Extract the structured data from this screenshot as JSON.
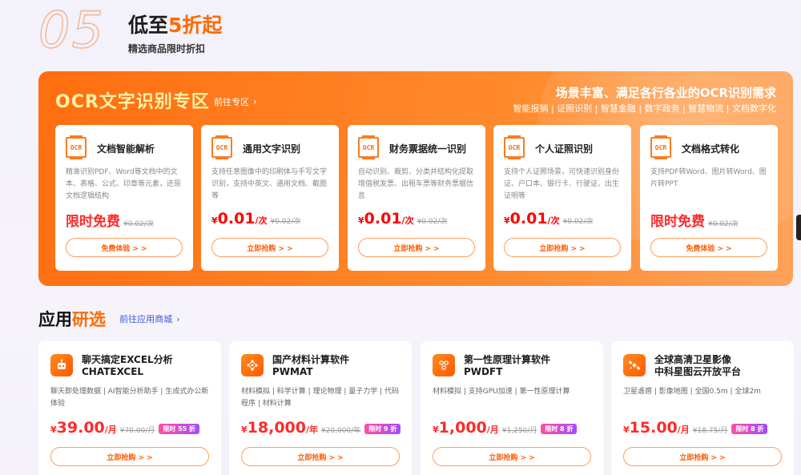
{
  "section": {
    "number": "05",
    "title_prefix": "低至",
    "title_highlight": "5折起",
    "subtitle": "精选商品限时折扣"
  },
  "ocr": {
    "title": "OCR文字识别专区",
    "link_label": "前往专区",
    "slogan": "场景丰富、满足各行各业的OCR识别需求",
    "tags": "智能报销 | 证照识别 | 智慧金融 | 数字政务 | 智慧物流 | 文档数字化",
    "icon_text": "OCR",
    "cards": [
      {
        "name": "文档智能解析",
        "desc": "精准识别PDF、Word等文档中的文本、表格、公式、印章等元素，还原文档逻辑结构",
        "free_label": "限时免费",
        "orig_price": "¥0.02/次",
        "button": "免费体验 > >"
      },
      {
        "name": "通用文字识别",
        "desc": "支持任意图像中的印刷体与手写文字识别，支持中英文、通用文档、截图等",
        "currency": "¥",
        "price": "0.01",
        "unit": "/次",
        "orig_price": "¥0.02/次",
        "button": "立即抢购 > >"
      },
      {
        "name": "财务票据统一识别",
        "desc": "自动识别、裁剪、分类并结构化提取增值税发票、出租车票等财务票据信息",
        "currency": "¥",
        "price": "0.01",
        "unit": "/次",
        "orig_price": "¥0.02/次",
        "button": "立即抢购 > >"
      },
      {
        "name": "个人证照识别",
        "desc": "支持个人证照场景，可快速识别身份证、户口本、银行卡、行驶证、出生证明等",
        "currency": "¥",
        "price": "0.01",
        "unit": "/次",
        "orig_price": "¥0.02/次",
        "button": "立即抢购 > >"
      },
      {
        "name": "文档格式转化",
        "desc": "支持PDF转Word、图片转Word、图片转PPT",
        "free_label": "限时免费",
        "orig_price": "¥0.02/次",
        "button": "免费体验 > >"
      }
    ]
  },
  "apps": {
    "title_prefix": "应用",
    "title_highlight": "研选",
    "link_label": "前往应用商城",
    "cards": [
      {
        "name_line1": "聊天搞定EXCEL分析",
        "name_line2": "CHATEXCEL",
        "icon": "robot-icon",
        "desc": "聊天即处理数据 | AI智能分析助手 | 生成式办公新体验",
        "currency": "¥",
        "price": "39.00",
        "unit": "/月",
        "orig_price": "¥70.00/月",
        "discount": "限时 55 折",
        "button": "立即抢购 > >"
      },
      {
        "name_line1": "国产材料计算软件",
        "name_line2": "PWMAT",
        "icon": "molecule-icon",
        "desc": "材料模拟 | 科学计算 | 理论物理 | 量子力学 | 代码程序 | 材料计算",
        "currency": "¥",
        "price": "18,000",
        "unit": "/年",
        "orig_price": "¥20,000/年",
        "discount": "限时 9 折",
        "button": "立即抢购 > >"
      },
      {
        "name_line1": "第一性原理计算软件",
        "name_line2": "PWDFT",
        "icon": "atom-cluster-icon",
        "desc": "材料模拟 | 支持GPU加速 | 第一性原理计算",
        "currency": "¥",
        "price": "1,000",
        "unit": "/月",
        "orig_price": "¥1,250/月",
        "discount": "限时 8 折",
        "button": "立即抢购 > >"
      },
      {
        "name_line1": "全球高清卫星影像",
        "name_line2": "中科星图云开放平台",
        "icon": "satellite-icon",
        "desc": "卫星遥感 | 影像地图 | 全国0.5m | 全球2m",
        "currency": "¥",
        "price": "15.00",
        "unit": "/月",
        "orig_price": "¥18.75/月",
        "discount": "限时 8 折",
        "button": "立即抢购 > >"
      }
    ]
  }
}
